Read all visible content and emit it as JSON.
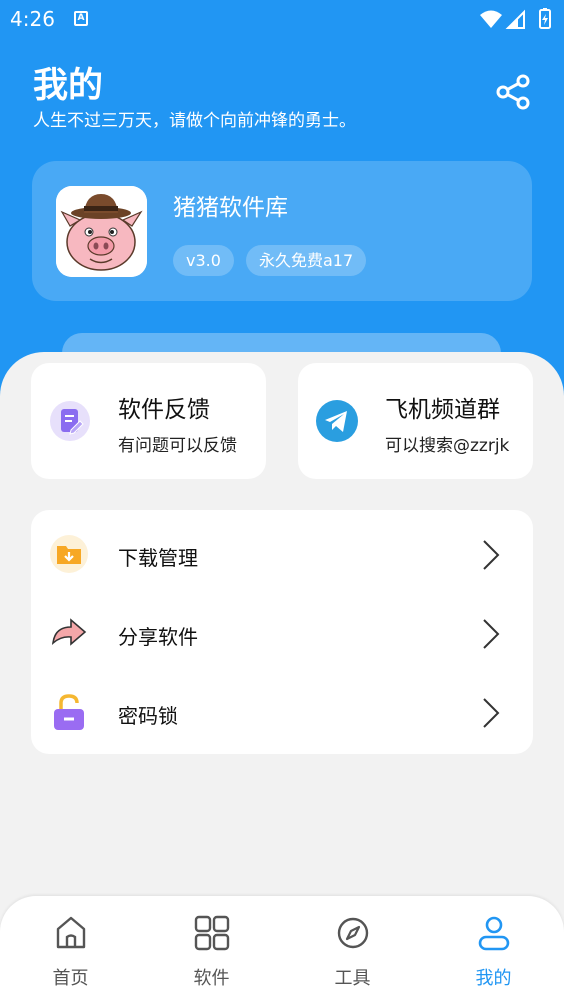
{
  "status_bar": {
    "time": "4:26",
    "notification_letter": "A"
  },
  "header": {
    "title": "我的",
    "subtitle": "人生不过三万天，请做个向前冲锋的勇士。"
  },
  "app_card": {
    "name": "猪猪软件库",
    "version": "v3.0",
    "tag": "永久免费a17"
  },
  "quick_actions": [
    {
      "title": "软件反馈",
      "desc": "有问题可以反馈",
      "icon": "feedback-icon"
    },
    {
      "title": "飞机频道群",
      "desc": "可以搜索@zzrjk",
      "icon": "telegram-icon"
    }
  ],
  "menu": [
    {
      "label": "下载管理",
      "icon": "download-folder-icon"
    },
    {
      "label": "分享软件",
      "icon": "share-arrow-icon"
    },
    {
      "label": "密码锁",
      "icon": "lock-icon"
    }
  ],
  "bottom_nav": [
    {
      "label": "首页",
      "icon": "home-icon"
    },
    {
      "label": "软件",
      "icon": "grid-icon"
    },
    {
      "label": "工具",
      "icon": "compass-icon"
    },
    {
      "label": "我的",
      "icon": "user-icon",
      "active": true
    }
  ],
  "colors": {
    "primary": "#2196f3",
    "background": "#f2f2f2",
    "card": "#ffffff"
  }
}
